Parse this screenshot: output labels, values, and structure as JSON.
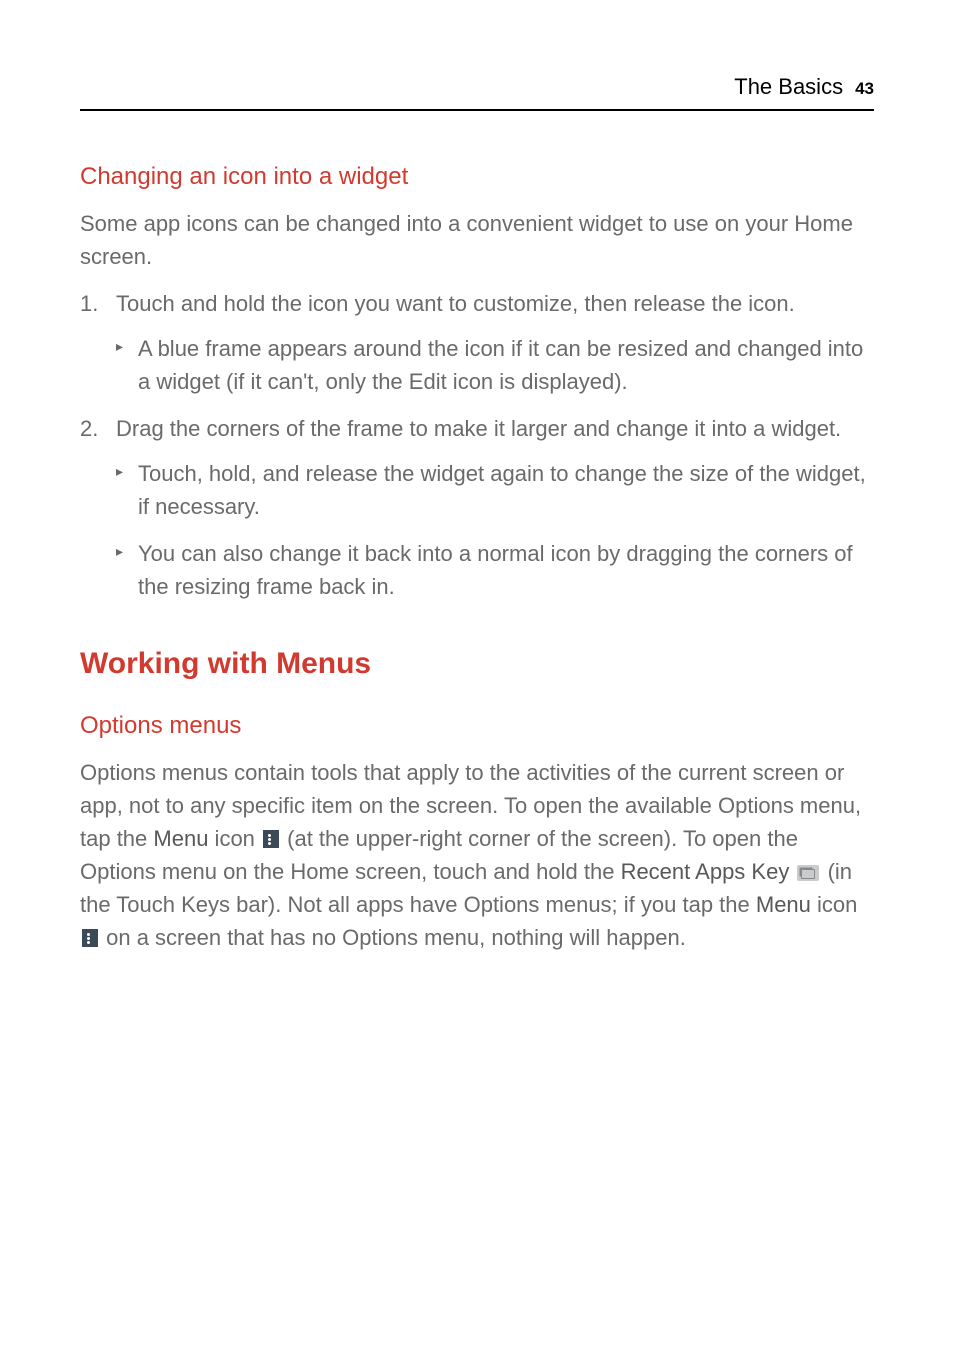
{
  "header": {
    "title": "The Basics",
    "page": "43"
  },
  "section1": {
    "heading": "Changing an icon into a widget",
    "intro": "Some app icons can be changed into a convenient widget to use on your Home screen.",
    "steps": [
      {
        "text": "Touch and hold the icon you want to customize, then release the icon.",
        "sub": [
          "A blue frame appears around the icon if it can be resized and changed into a widget (if it can't, only the Edit icon is displayed)."
        ]
      },
      {
        "text": "Drag the corners of the frame to make it larger and change it into a widget.",
        "sub": [
          "Touch, hold, and release the widget again to change the size of the widget, if necessary.",
          "You can also change it back into a normal icon by dragging the corners of the resizing frame back in."
        ]
      }
    ]
  },
  "section2": {
    "heading": "Working with Menus",
    "sub_heading": "Options menus",
    "para_parts": {
      "p1": "Options menus contain tools that apply to the activities of the current screen or app, not to any specific item on the screen. To open the available Options menu, tap the ",
      "menu_label": "Menu",
      "p2": " icon ",
      "p3": " (at the upper-right corner of the screen). To open the Options menu on the Home screen, touch and hold the ",
      "recent_label": "Recent Apps Key",
      "p4": " ",
      "p5": " (in the Touch Keys bar). Not all apps have Options menus; if you tap the ",
      "p6": " icon ",
      "p7": " on a screen that has no Options menu, nothing will happen."
    }
  }
}
